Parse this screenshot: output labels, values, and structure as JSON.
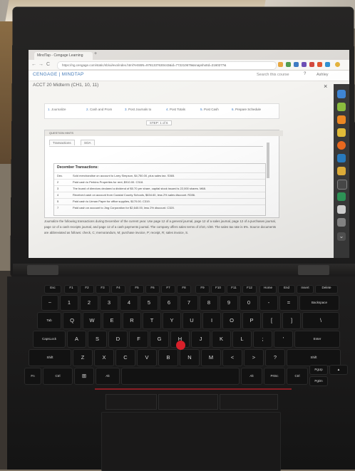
{
  "browser": {
    "tab_title": "MindTap - Cengage Learning",
    "new_tab": "+",
    "url": "https://ng.cengage.com/static/nb/ui/evo/index.html?eISBN=9781337630443&id=772210679&snapshotId=2160277&",
    "nav": {
      "back": "←",
      "forward": "→",
      "reload": "C"
    }
  },
  "header": {
    "brand": "CENGAGE | MINDTAP",
    "search_placeholder": "Search this course",
    "help": "?",
    "user": "Ashley"
  },
  "course": {
    "title": "ACCT 20 Midterm (CH1, 10, 11)"
  },
  "steps": [
    {
      "num": "1",
      "label": "Journalize"
    },
    {
      "num": "2",
      "label": "Cash and Prom"
    },
    {
      "num": "3",
      "label": "Post Journals to"
    },
    {
      "num": "4",
      "label": "Post Totals"
    },
    {
      "num": "5",
      "label": "Post Cash"
    },
    {
      "num": "6",
      "label": "Prepare Schedule"
    }
  ],
  "step_counter": "STEP: 1 of 6",
  "question_panel": {
    "header": "QUESTION HINTS",
    "tabs": [
      "Transactions",
      "SOA"
    ],
    "table_title": "December Transactions:",
    "rows": [
      {
        "date": "Dec.",
        "text": "Sold merchandise on account to Larry Simpson, $4,750.00, plus sales tax. S365."
      },
      {
        "date": "2",
        "text": "Paid cash to Perkins Properties for rent, $910.00. C318."
      },
      {
        "date": "3",
        "text": "The board of directors declared a dividend of $0.70 per share, capital stock issued is 22,000 shares. M68."
      },
      {
        "date": "4",
        "text": "Received cash on account from Coastal County Schools, $634.60, less 2% sales discount. R286."
      },
      {
        "date": "5",
        "text": "Paid cash to Urman Paper for office supplies, $170.00. C319."
      },
      {
        "date": "7",
        "text": "Paid cash on account to Jing Corporation for $2,640.00, less 2% discount. C320."
      }
    ]
  },
  "instructions": "Journalize the following transactions during December of the current year. Use page 12 of a general journal, page 12 of a sales journal, page 12 of a purchases journal, page 12 of a cash receipts journal, and page 12 of a cash payments journal. The company offers sales terms of 2/10, n/30. The sales tax rate is 6%. Source documents are abbreviated as follows: check, C; memorandum, M; purchase invoice, P; receipt, R; sales invoice, S.",
  "keyboard": {
    "row_fn": [
      "Esc",
      "F1",
      "F2",
      "F3",
      "F4",
      "F5",
      "F6",
      "F7",
      "F8",
      "F9",
      "F10",
      "F11",
      "F12",
      "Home",
      "End",
      "Insert",
      "Delete"
    ],
    "row_num": [
      "~",
      "1",
      "2",
      "3",
      "4",
      "5",
      "6",
      "7",
      "8",
      "9",
      "0",
      "-",
      "=",
      "Backspace"
    ],
    "row_q": [
      "Tab",
      "Q",
      "W",
      "E",
      "R",
      "T",
      "Y",
      "U",
      "I",
      "O",
      "P",
      "[",
      "]",
      "\\"
    ],
    "row_a": [
      "CapsLock",
      "A",
      "S",
      "D",
      "F",
      "G",
      "H",
      "J",
      "K",
      "L",
      ";",
      "'",
      "Enter"
    ],
    "row_z": [
      "Shift",
      "Z",
      "X",
      "C",
      "V",
      "B",
      "N",
      "M",
      "<",
      ">",
      "?",
      "Shift"
    ],
    "row_bottom": [
      "Fn",
      "Ctrl",
      "⊞",
      "Alt",
      "",
      "Alt",
      "PrtSc",
      "Ctrl",
      "PgUp",
      "▲",
      "PgDn"
    ]
  }
}
